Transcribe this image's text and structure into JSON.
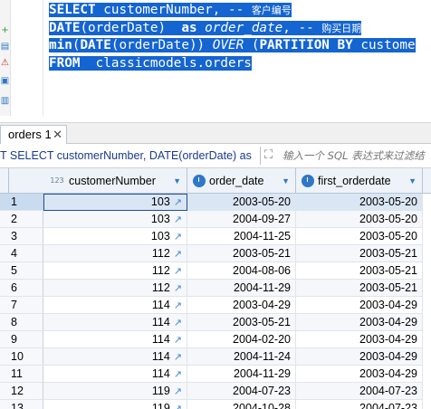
{
  "editor": {
    "lines": [
      [
        {
          "t": "SELECT",
          "kw": true
        },
        {
          "t": " customerNumber, -- "
        },
        {
          "t": "客户编号",
          "cm": true
        }
      ],
      [
        {
          "t": "DATE",
          "kw": true
        },
        {
          "t": "(orderDate)  "
        },
        {
          "t": "as",
          "kw": true
        },
        {
          "t": " "
        },
        {
          "t": "order_date",
          "it": true
        },
        {
          "t": ", -- "
        },
        {
          "t": "购买日期",
          "cm": true
        }
      ],
      [
        {
          "t": "min",
          "kw": true
        },
        {
          "t": "("
        },
        {
          "t": "DATE",
          "kw": true
        },
        {
          "t": "(orderDate)) "
        },
        {
          "t": "OVER",
          "it": true
        },
        {
          "t": " ("
        },
        {
          "t": "PARTITION BY",
          "kw": true
        },
        {
          "t": " custome"
        }
      ],
      [
        {
          "t": "FROM",
          "kw": true
        },
        {
          "t": "  classicmodels.orders"
        }
      ]
    ]
  },
  "tabs": {
    "results_tab": "orders 1",
    "close_label": "✕"
  },
  "filter": {
    "sql_text": "T SELECT customerNumber, DATE(orderDate) as",
    "placeholder": "输入一个 SQL 表达式来过滤结"
  },
  "grid": {
    "columns": [
      {
        "key": "customerNumber",
        "label": "customerNumber",
        "type": "number",
        "type_badge": "123"
      },
      {
        "key": "order_date",
        "label": "order_date",
        "type": "date"
      },
      {
        "key": "first_orderdate",
        "label": "first_orderdate",
        "type": "date"
      }
    ],
    "rows": [
      {
        "n": "1",
        "customerNumber": "103",
        "order_date": "2003-05-20",
        "first_orderdate": "2003-05-20"
      },
      {
        "n": "2",
        "customerNumber": "103",
        "order_date": "2004-09-27",
        "first_orderdate": "2003-05-20"
      },
      {
        "n": "3",
        "customerNumber": "103",
        "order_date": "2004-11-25",
        "first_orderdate": "2003-05-20"
      },
      {
        "n": "4",
        "customerNumber": "112",
        "order_date": "2003-05-21",
        "first_orderdate": "2003-05-21"
      },
      {
        "n": "5",
        "customerNumber": "112",
        "order_date": "2004-08-06",
        "first_orderdate": "2003-05-21"
      },
      {
        "n": "6",
        "customerNumber": "112",
        "order_date": "2004-11-29",
        "first_orderdate": "2003-05-21"
      },
      {
        "n": "7",
        "customerNumber": "114",
        "order_date": "2003-04-29",
        "first_orderdate": "2003-04-29"
      },
      {
        "n": "8",
        "customerNumber": "114",
        "order_date": "2003-05-21",
        "first_orderdate": "2003-04-29"
      },
      {
        "n": "9",
        "customerNumber": "114",
        "order_date": "2004-02-20",
        "first_orderdate": "2003-04-29"
      },
      {
        "n": "10",
        "customerNumber": "114",
        "order_date": "2004-11-24",
        "first_orderdate": "2003-04-29"
      },
      {
        "n": "11",
        "customerNumber": "114",
        "order_date": "2004-11-29",
        "first_orderdate": "2003-04-29"
      },
      {
        "n": "12",
        "customerNumber": "119",
        "order_date": "2004-07-23",
        "first_orderdate": "2004-07-23"
      },
      {
        "n": "13",
        "customerNumber": "119",
        "order_date": "2004-10-28",
        "first_orderdate": "2004-07-23"
      }
    ]
  },
  "colors": {
    "selection": "#1464d2",
    "accent": "#2e78c7",
    "link_icon": "#3f88d8"
  },
  "icons": [
    "run-icon",
    "warning-icon",
    "filter-icon",
    "link-icon",
    "date-type-icon",
    "sort-arrow-icon"
  ]
}
